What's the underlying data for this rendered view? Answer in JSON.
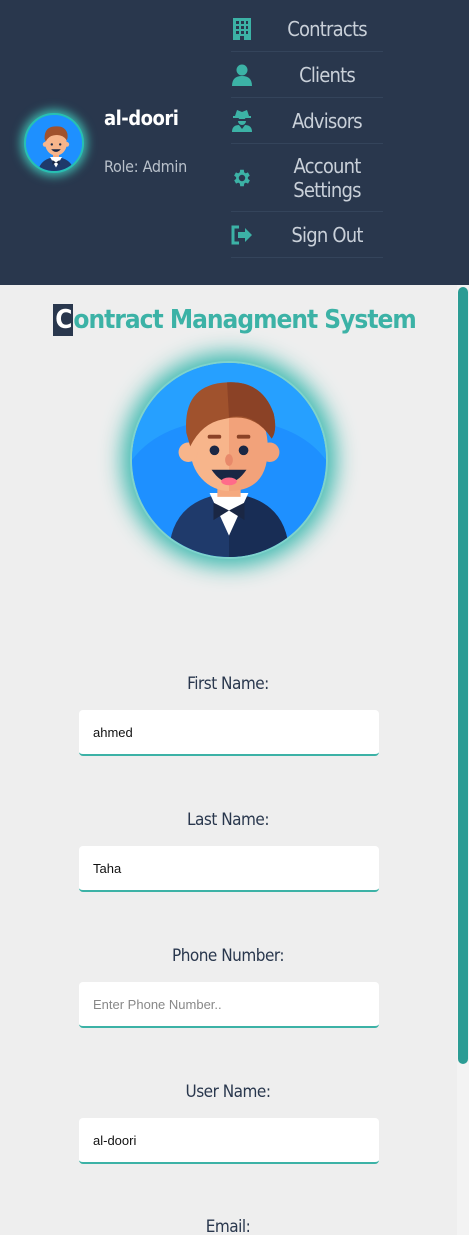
{
  "sidebar_profile": {
    "name": "al-doori",
    "role": "Role: Admin"
  },
  "nav": {
    "items": [
      {
        "label": "Contracts",
        "icon": "building-icon"
      },
      {
        "label": "Clients",
        "icon": "user-icon"
      },
      {
        "label": "Advisors",
        "icon": "user-secret-icon"
      },
      {
        "label": "Account Settings",
        "icon": "gear-icon"
      },
      {
        "label": "Sign Out",
        "icon": "sign-out-icon"
      }
    ]
  },
  "main": {
    "title_first": "C",
    "title_rest": "ontract Managment System"
  },
  "form": {
    "first_name": {
      "label": "First Name:",
      "value": "ahmed",
      "placeholder": ""
    },
    "last_name": {
      "label": "Last Name:",
      "value": "Taha",
      "placeholder": ""
    },
    "phone": {
      "label": "Phone Number:",
      "value": "",
      "placeholder": "Enter Phone Number.."
    },
    "username": {
      "label": "User Name:",
      "value": "al-doori",
      "placeholder": ""
    },
    "email": {
      "label": "Email:"
    }
  },
  "colors": {
    "header_bg": "#29374d",
    "accent": "#3cb2a6",
    "nav_text": "#c9d0d9",
    "page_bg": "#eeeeee"
  }
}
